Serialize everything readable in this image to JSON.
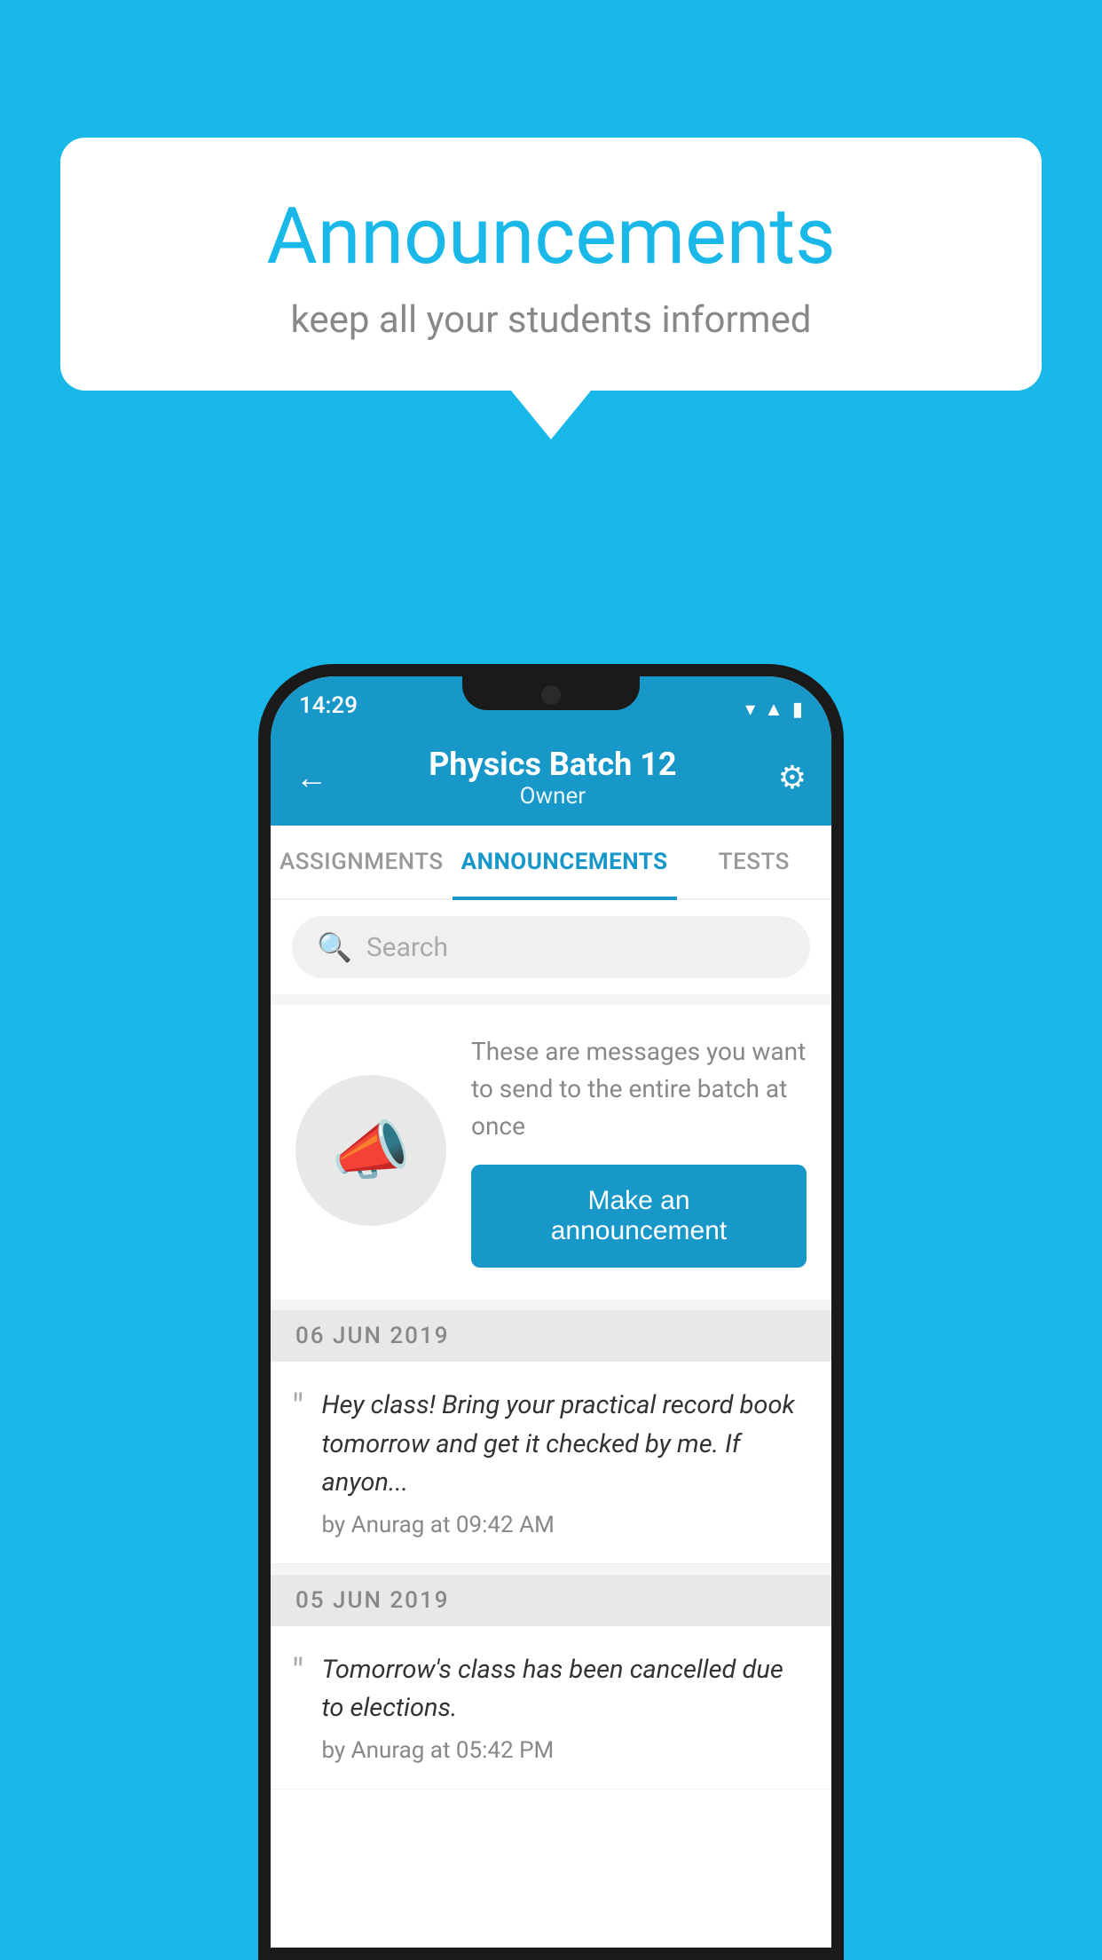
{
  "bubble": {
    "title": "Announcements",
    "subtitle": "keep all your students informed"
  },
  "statusBar": {
    "time": "14:29",
    "icons": [
      "wifi",
      "signal",
      "battery"
    ]
  },
  "header": {
    "title": "Physics Batch 12",
    "subtitle": "Owner",
    "backLabel": "←",
    "gearLabel": "⚙"
  },
  "tabs": [
    {
      "label": "ASSIGNMENTS",
      "active": false
    },
    {
      "label": "ANNOUNCEMENTS",
      "active": true
    },
    {
      "label": "TESTS",
      "active": false
    },
    {
      "label": "…",
      "active": false
    }
  ],
  "search": {
    "placeholder": "Search"
  },
  "promoCard": {
    "text": "These are messages you want to send to the entire batch at once",
    "buttonLabel": "Make an announcement"
  },
  "announcements": [
    {
      "date": "06  JUN  2019",
      "text": "Hey class! Bring your practical record book tomorrow and get it checked by me. If anyon...",
      "author": "by Anurag at 09:42 AM"
    },
    {
      "date": "05  JUN  2019",
      "text": "Tomorrow's class has been cancelled due to elections.",
      "author": "by Anurag at 05:42 PM"
    }
  ],
  "colors": {
    "primary": "#1897c9",
    "background": "#1ab8e8",
    "white": "#ffffff"
  }
}
